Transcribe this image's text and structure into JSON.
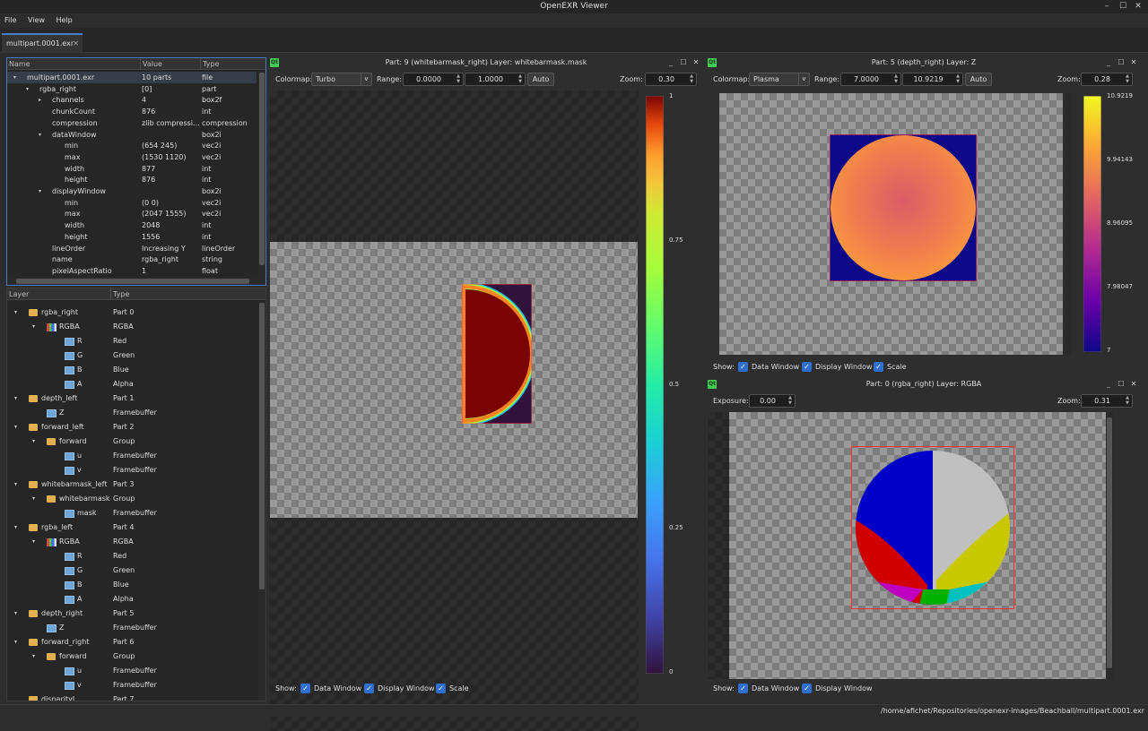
{
  "window": {
    "title": "OpenEXR Viewer"
  },
  "menu": [
    "File",
    "View",
    "Help"
  ],
  "tab": {
    "label": "multipart.0001.exr"
  },
  "header_tree": {
    "columns": [
      "Name",
      "Value",
      "Type"
    ],
    "rows": [
      {
        "name": "multipart.0001.exr",
        "value": "10 parts",
        "type": "file"
      },
      {
        "name": "rgba_right",
        "value": "[0]",
        "type": "part"
      },
      {
        "name": "channels",
        "value": "4",
        "type": "box2f"
      },
      {
        "name": "chunkCount",
        "value": "876",
        "type": "int"
      },
      {
        "name": "compression",
        "value": "zlib compressi...",
        "type": "compression"
      },
      {
        "name": "dataWindow",
        "value": "",
        "type": "box2i"
      },
      {
        "name": "min",
        "value": "(654 245)",
        "type": "vec2i"
      },
      {
        "name": "max",
        "value": "(1530 1120)",
        "type": "vec2i"
      },
      {
        "name": "width",
        "value": "877",
        "type": "int"
      },
      {
        "name": "height",
        "value": "876",
        "type": "int"
      },
      {
        "name": "displayWindow",
        "value": "",
        "type": "box2i"
      },
      {
        "name": "min",
        "value": "(0 0)",
        "type": "vec2i"
      },
      {
        "name": "max",
        "value": "(2047 1555)",
        "type": "vec2i"
      },
      {
        "name": "width",
        "value": "2048",
        "type": "int"
      },
      {
        "name": "height",
        "value": "1556",
        "type": "int"
      },
      {
        "name": "lineOrder",
        "value": "Increasing Y",
        "type": "lineOrder"
      },
      {
        "name": "name",
        "value": "rgba_right",
        "type": "string"
      },
      {
        "name": "pixelAspectRatio",
        "value": "1",
        "type": "float"
      }
    ]
  },
  "layer_tree": {
    "columns": [
      "Layer",
      "Type"
    ],
    "rows": [
      {
        "name": "rgba_right",
        "type": "Part 0",
        "icon": "folder-icon"
      },
      {
        "name": "RGBA",
        "type": "RGBA",
        "icon": "rgba-icon"
      },
      {
        "name": "R",
        "type": "Red",
        "icon": "channel-icon"
      },
      {
        "name": "G",
        "type": "Green",
        "icon": "channel-icon"
      },
      {
        "name": "B",
        "type": "Blue",
        "icon": "channel-icon"
      },
      {
        "name": "A",
        "type": "Alpha",
        "icon": "channel-icon"
      },
      {
        "name": "depth_left",
        "type": "Part 1",
        "icon": "folder-icon"
      },
      {
        "name": "Z",
        "type": "Framebuffer",
        "icon": "channel-icon"
      },
      {
        "name": "forward_left",
        "type": "Part 2",
        "icon": "folder-icon"
      },
      {
        "name": "forward",
        "type": "Group",
        "icon": "folder-icon"
      },
      {
        "name": "u",
        "type": "Framebuffer",
        "icon": "channel-icon"
      },
      {
        "name": "v",
        "type": "Framebuffer",
        "icon": "channel-icon"
      },
      {
        "name": "whitebarmask_left",
        "type": "Part 3",
        "icon": "folder-icon"
      },
      {
        "name": "whitebarmask",
        "type": "Group",
        "icon": "folder-icon"
      },
      {
        "name": "mask",
        "type": "Framebuffer",
        "icon": "channel-icon"
      },
      {
        "name": "rgba_left",
        "type": "Part 4",
        "icon": "folder-icon"
      },
      {
        "name": "RGBA",
        "type": "RGBA",
        "icon": "rgba-icon"
      },
      {
        "name": "R",
        "type": "Red",
        "icon": "channel-icon"
      },
      {
        "name": "G",
        "type": "Green",
        "icon": "channel-icon"
      },
      {
        "name": "B",
        "type": "Blue",
        "icon": "channel-icon"
      },
      {
        "name": "A",
        "type": "Alpha",
        "icon": "channel-icon"
      },
      {
        "name": "depth_right",
        "type": "Part 5",
        "icon": "folder-icon"
      },
      {
        "name": "Z",
        "type": "Framebuffer",
        "icon": "channel-icon"
      },
      {
        "name": "forward_right",
        "type": "Part 6",
        "icon": "folder-icon"
      },
      {
        "name": "forward",
        "type": "Group",
        "icon": "folder-icon"
      },
      {
        "name": "u",
        "type": "Framebuffer",
        "icon": "channel-icon"
      },
      {
        "name": "v",
        "type": "Framebuffer",
        "icon": "channel-icon"
      },
      {
        "name": "disparityL",
        "type": "Part 7",
        "icon": "folder-icon"
      }
    ]
  },
  "view_mask": {
    "title": "Part: 9 (whitebarmask_right) Layer: whitebarmask.mask",
    "colormap_label": "Colormap:",
    "colormap": "Turbo",
    "range_label": "Range:",
    "range_min": "0.0000",
    "range_max": "1.0000",
    "auto_label": "Auto",
    "zoom_label": "Zoom:",
    "zoom": "0.30",
    "scale_ticks": [
      "1",
      "0.75",
      "0.5",
      "0.25",
      "0"
    ],
    "show_label": "Show:",
    "checks": [
      "Data Window",
      "Display Window",
      "Scale"
    ]
  },
  "view_depth": {
    "title": "Part: 5 (depth_right) Layer: Z",
    "colormap_label": "Colormap:",
    "colormap": "Plasma",
    "range_label": "Range:",
    "range_min": "7.0000",
    "range_max": "10.9219",
    "auto_label": "Auto",
    "zoom_label": "Zoom:",
    "zoom": "0.28",
    "scale_ticks": [
      "10.9219",
      "9.94143",
      "8.96095",
      "7.98047",
      "7"
    ],
    "show_label": "Show:",
    "checks": [
      "Data Window",
      "Display Window",
      "Scale"
    ]
  },
  "view_rgba": {
    "title": "Part: 0 (rgba_right) Layer: RGBA",
    "exposure_label": "Exposure:",
    "exposure": "0.00",
    "zoom_label": "Zoom:",
    "zoom": "0.31",
    "show_label": "Show:",
    "checks": [
      "Data Window",
      "Display Window"
    ]
  },
  "status": {
    "path": "/home/afichet/Repositories/openexr-images/Beachball/multipart.0001.exr"
  },
  "colors": {
    "accent": "#2f6fd0",
    "qt_logo": "#41cd52"
  }
}
